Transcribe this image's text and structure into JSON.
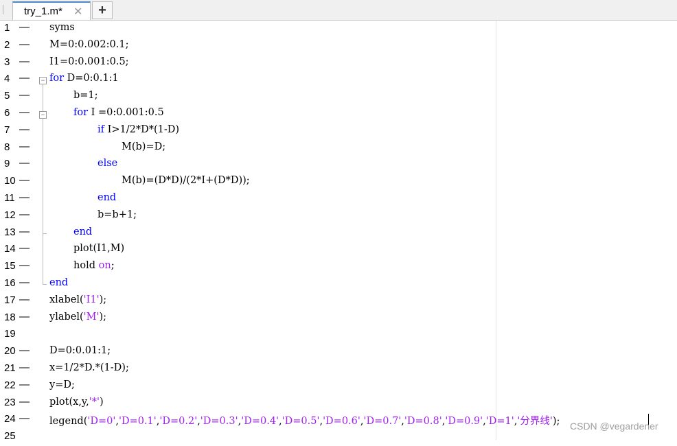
{
  "tab": {
    "title": "try_1.m*",
    "close_glyph": "✕",
    "add_glyph": "+"
  },
  "code_lines": [
    {
      "n": "1",
      "dash": "—",
      "indent": 0,
      "parts": [
        [
          "t",
          "syms"
        ]
      ]
    },
    {
      "n": "2",
      "dash": "—",
      "indent": 0,
      "parts": [
        [
          "t",
          "M=0:0.002:0.1;"
        ]
      ]
    },
    {
      "n": "3",
      "dash": "—",
      "indent": 0,
      "parts": [
        [
          "t",
          "I1=0:0.001:0.5;"
        ]
      ]
    },
    {
      "n": "4",
      "dash": "—",
      "indent": 0,
      "parts": [
        [
          "k",
          "for"
        ],
        [
          "t",
          " D=0:0.1:1"
        ]
      ]
    },
    {
      "n": "5",
      "dash": "—",
      "indent": 1,
      "parts": [
        [
          "t",
          "b=1;"
        ]
      ]
    },
    {
      "n": "6",
      "dash": "—",
      "indent": 1,
      "parts": [
        [
          "k",
          "for"
        ],
        [
          "t",
          " I =0:0.001:0.5"
        ]
      ]
    },
    {
      "n": "7",
      "dash": "—",
      "indent": 2,
      "parts": [
        [
          "k",
          "if"
        ],
        [
          "t",
          " I>1/2*D*(1-D)"
        ]
      ]
    },
    {
      "n": "8",
      "dash": "—",
      "indent": 3,
      "parts": [
        [
          "t",
          "M(b)=D;"
        ]
      ]
    },
    {
      "n": "9",
      "dash": "—",
      "indent": 2,
      "parts": [
        [
          "k",
          "else"
        ]
      ]
    },
    {
      "n": "10",
      "dash": "—",
      "indent": 3,
      "parts": [
        [
          "t",
          "M(b)=(D*D)/(2*I+(D*D));"
        ]
      ]
    },
    {
      "n": "11",
      "dash": "—",
      "indent": 2,
      "parts": [
        [
          "k",
          "end"
        ]
      ]
    },
    {
      "n": "12",
      "dash": "—",
      "indent": 2,
      "parts": [
        [
          "t",
          "b=b+1;"
        ]
      ]
    },
    {
      "n": "13",
      "dash": "—",
      "indent": 1,
      "parts": [
        [
          "k",
          "end"
        ]
      ]
    },
    {
      "n": "14",
      "dash": "—",
      "indent": 1,
      "parts": [
        [
          "t",
          "plot(I1,M)"
        ]
      ]
    },
    {
      "n": "15",
      "dash": "—",
      "indent": 1,
      "parts": [
        [
          "t",
          "hold "
        ],
        [
          "s",
          "on"
        ],
        [
          "t",
          ";"
        ]
      ]
    },
    {
      "n": "16",
      "dash": "—",
      "indent": 0,
      "parts": [
        [
          "k",
          "end"
        ]
      ]
    },
    {
      "n": "17",
      "dash": "—",
      "indent": 0,
      "parts": [
        [
          "t",
          "xlabel("
        ],
        [
          "s",
          "'I1'"
        ],
        [
          "t",
          ");"
        ]
      ]
    },
    {
      "n": "18",
      "dash": "—",
      "indent": 0,
      "parts": [
        [
          "t",
          "ylabel("
        ],
        [
          "s",
          "'M'"
        ],
        [
          "t",
          ");"
        ]
      ]
    },
    {
      "n": "19",
      "dash": "",
      "indent": 0,
      "parts": []
    },
    {
      "n": "20",
      "dash": "—",
      "indent": 0,
      "parts": [
        [
          "t",
          "D=0:0.01:1;"
        ]
      ]
    },
    {
      "n": "21",
      "dash": "—",
      "indent": 0,
      "parts": [
        [
          "t",
          "x=1/2*D.*(1-D);"
        ]
      ]
    },
    {
      "n": "22",
      "dash": "—",
      "indent": 0,
      "parts": [
        [
          "t",
          "y=D;"
        ]
      ]
    },
    {
      "n": "23",
      "dash": "—",
      "indent": 0,
      "parts": [
        [
          "t",
          "plot(x,y,"
        ],
        [
          "s",
          "'*'"
        ],
        [
          "t",
          ")"
        ]
      ]
    },
    {
      "n": "24",
      "dash": "—",
      "indent": 0,
      "parts": [
        [
          "t",
          "legend("
        ],
        [
          "s",
          "'D=0'"
        ],
        [
          "t",
          ","
        ],
        [
          "s",
          "'D=0.1'"
        ],
        [
          "t",
          ","
        ],
        [
          "s",
          "'D=0.2'"
        ],
        [
          "t",
          ","
        ],
        [
          "s",
          "'D=0.3'"
        ],
        [
          "t",
          ","
        ],
        [
          "s",
          "'D=0.4'"
        ],
        [
          "t",
          ","
        ],
        [
          "s",
          "'D=0.5'"
        ],
        [
          "t",
          ","
        ],
        [
          "s",
          "'D=0.6'"
        ],
        [
          "t",
          ","
        ],
        [
          "s",
          "'D=0.7'"
        ],
        [
          "t",
          ","
        ],
        [
          "s",
          "'D=0.8'"
        ],
        [
          "t",
          ","
        ],
        [
          "s",
          "'D=0.9'"
        ],
        [
          "t",
          ","
        ],
        [
          "s",
          "'D=1'"
        ],
        [
          "t",
          ","
        ],
        [
          "s",
          "'分界线'"
        ],
        [
          "t",
          ");"
        ]
      ]
    },
    {
      "n": "25",
      "dash": "",
      "indent": 0,
      "parts": []
    }
  ],
  "watermark": "CSDN @vegardener",
  "colors": {
    "keyword": "#0000ff",
    "string": "#a020f0",
    "text": "#000000",
    "tab_accent": "#4a88c7"
  },
  "icons": {
    "fold_open": "minus-box-icon",
    "close": "close-icon",
    "add": "plus-icon"
  }
}
